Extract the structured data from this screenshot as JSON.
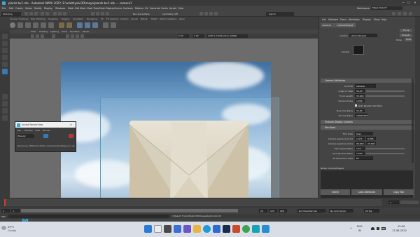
{
  "titlebar": {
    "title": "plants bx1.mb - Autodesk MAYA 2022: E:\\arlothyslv\\3D\\maya\\plants bx1.mb    ---    camera1",
    "minimize": "—",
    "maximize": "☐",
    "close": "✕"
  },
  "menubar": {
    "items": [
      "File",
      "Edit",
      "Create",
      "Select",
      "Modify",
      "Display",
      "Windows",
      "Mesh",
      "Edit Mesh",
      "Mesh Tools",
      "Mesh Display",
      "Curves",
      "Surfaces",
      "Deform",
      "UV",
      "Generate",
      "Cache",
      "Arnold",
      "Help"
    ],
    "workspace_label": "Workspace:",
    "workspace_value": "Maya Classic*"
  },
  "statusline": {
    "mode": "Modeling",
    "no_live_surface": "No Live Surface",
    "symmetry": "Symmetry: Off",
    "sign_in": "Sign In"
  },
  "shelf": {
    "tabs": [
      "Curves / Surfaces",
      "Poly Modeling",
      "Sculpting",
      "Rigging",
      "Animation",
      "Rendering",
      "FX",
      "FX Caching",
      "Custom",
      "Arnold",
      "Bifrost",
      "MASH",
      "Motion Graphics",
      "XGen"
    ]
  },
  "viewport": {
    "menu": [
      "View",
      "Shading",
      "Lighting",
      "Show",
      "Renderer",
      "Panels"
    ],
    "gamma_value": "0.00",
    "exposure_value": "1.00",
    "color_space": "ACES 1.0 SDR-video (sRGB)"
  },
  "renderwin": {
    "title": "Arnold RenderView",
    "menu": [
      "File",
      "Window",
      "View",
      "Render"
    ],
    "beauty": "Beauty",
    "status": "Rendering | 1380x710 | 00:00 | camera1|cameraShape1 | 1 sample"
  },
  "logo": {
    "letter": "M"
  },
  "attr": {
    "tabs": [
      "List",
      "Selected",
      "Focus",
      "Attributes",
      "Display",
      "Show",
      "Help"
    ],
    "node_tabs": [
      "camera1",
      "cameraShape1"
    ],
    "camera_label": "camera:",
    "camera_value": "cameraShape1",
    "focus": "Focus",
    "presets": "Presets",
    "show": "Show",
    "hide": "Hide",
    "sample_label": "Sample",
    "sections": {
      "camera_attributes": "Camera Attributes",
      "frustum": "Frustum Display Controls",
      "film_back": "Film Back"
    },
    "rows": {
      "controls": {
        "label": "Controls",
        "value": "Camera"
      },
      "angle_of_view": {
        "label": "Angle of View",
        "value": "54.43"
      },
      "focal_length": {
        "label": "Focal Length",
        "value": "35.000"
      },
      "camera_scale": {
        "label": "Camera Scale",
        "value": "1.000"
      },
      "auto_render_clip": {
        "label": "Auto Render Clip Plane"
      },
      "near_clip": {
        "label": "Near Clip Plane",
        "value": "0.100"
      },
      "far_clip": {
        "label": "Far Clip Plane",
        "value": "10000.000"
      },
      "film_gate": {
        "label": "Film Gate",
        "value": "User"
      },
      "aperture_inch": {
        "label": "Camera Aperture (inch)",
        "value1": "1.417",
        "value2": "0.945"
      },
      "aperture_mm": {
        "label": "Camera Aperture (mm)",
        "value1": "36.000",
        "value2": "24.000"
      },
      "film_aspect": {
        "label": "Film Aspect Ratio",
        "value": "1.50"
      },
      "lens_squeeze": {
        "label": "Lens Squeeze Ratio",
        "value": "1.000"
      },
      "fit_resolution": {
        "label": "Fit Resolution Gate",
        "value": "Fill"
      }
    },
    "notes_label": "Notes: cameraShape1",
    "buttons": [
      "Select",
      "Load Attributes",
      "Copy Tab"
    ]
  },
  "timeline": {
    "ticks": [
      "1",
      "5",
      "10",
      "15",
      "20",
      "25",
      "30",
      "35",
      "40",
      "45",
      "50",
      "55",
      "60",
      "65",
      "70",
      "75",
      "80",
      "85",
      "90",
      "95",
      "100",
      "105",
      "110",
      "115",
      "120"
    ],
    "current_frame": "1"
  },
  "rangebar": {
    "start": "1",
    "start2": "1",
    "end": "24",
    "end2": "120",
    "end3": "200",
    "character_set": "No Character Set",
    "anim_layer": "No Anim Layer",
    "fps": "24 fps"
  },
  "cmdline": {
    "mel": "MEL",
    "result": "// Result: E:/arlothyslv/3D/maya/plants bx1.mb"
  },
  "taskbar": {
    "temp": "29°C",
    "weather": "Cloudy",
    "lang1": "ENG",
    "lang2": "IN",
    "time": "15:06",
    "date": "17-08-2022"
  },
  "colors": {
    "accent": "#3aa8d8",
    "gate_border": "#5d9ab5",
    "maya_bg": "#444444"
  }
}
